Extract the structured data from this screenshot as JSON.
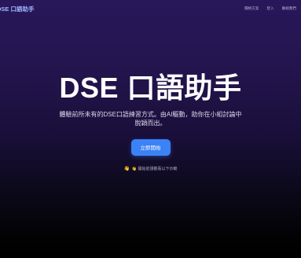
{
  "nav": {
    "brand": "DSE 口語助手",
    "links": [
      "價格方案",
      "登入",
      "聯絡我們"
    ]
  },
  "hero": {
    "title": "DSE 口語助手",
    "subtitle": "體驗前所未有的DSE口語練習方式。由AI驅動，助你在小組討論中脫穎而出。",
    "cta_label": "立即開始",
    "hint_icon": "👋",
    "hint_text": "👋 開始前請觀看以下示範"
  },
  "colors": {
    "accent": "#3b82f6",
    "brand": "#9fb6ff",
    "background_top": "#28175a",
    "background_bottom": "#000000"
  }
}
